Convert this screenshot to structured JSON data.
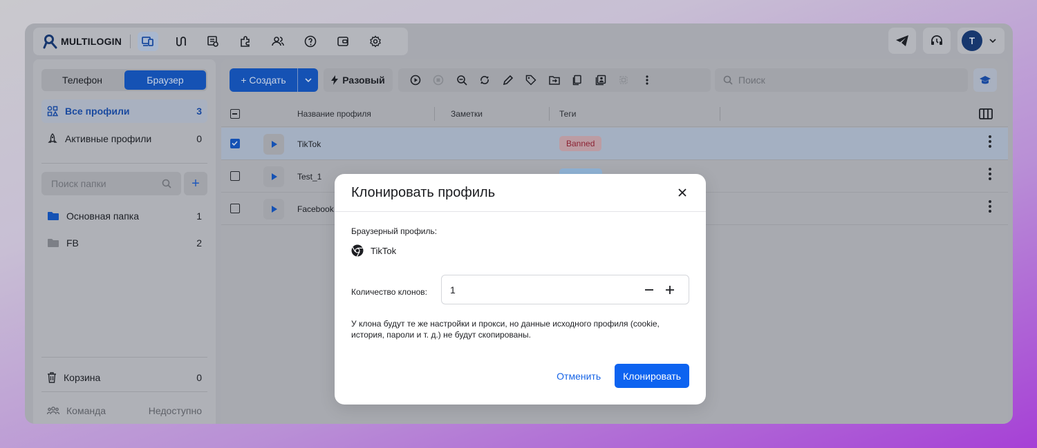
{
  "app": {
    "brand": "MULTILOGIN"
  },
  "topbar": {
    "nav_icons": [
      "profiles-icon",
      "routes-icon",
      "proxy-icon",
      "extensions-icon",
      "team-icon",
      "help-icon",
      "wallet-icon",
      "settings-icon"
    ],
    "right": {
      "avatar_letter": "T"
    }
  },
  "sidebar": {
    "tabs": [
      "Телефон",
      "Браузер"
    ],
    "active_tab": "Браузер",
    "all_profiles": {
      "label": "Все профили",
      "count": "3"
    },
    "active_profiles": {
      "label": "Активные профили",
      "count": "0"
    },
    "folder_search_placeholder": "Поиск папки",
    "folders": [
      {
        "label": "Основная папка",
        "count": "1",
        "color": "#1552b4"
      },
      {
        "label": "FB",
        "count": "2",
        "color": "#7c7f86"
      }
    ],
    "trash": {
      "label": "Корзина",
      "count": "0"
    },
    "team": {
      "label": "Команда",
      "status": "Недоступно"
    }
  },
  "toolbar": {
    "create_label": "+ Создать",
    "oneoff_label": "Разовый",
    "search_placeholder": "Поиск"
  },
  "table": {
    "columns": [
      "Название профиля",
      "Заметки",
      "Теги"
    ],
    "rows": [
      {
        "name": "TikTok",
        "tag": "Banned",
        "selected": true
      },
      {
        "name": "Test_1",
        "tag": "",
        "selected": false
      },
      {
        "name": "Facebook",
        "tag": "",
        "selected": false
      }
    ]
  },
  "modal": {
    "title": "Клонировать профиль",
    "profile_label": "Браузерный профиль:",
    "profile_name": "TikTok",
    "quantity_label": "Количество клонов:",
    "quantity_value": "1",
    "note": "У клона будут те же настройки и прокси, но данные исходного профиля (cookie, история, пароли и т. д.) не будут скопированы.",
    "cancel_label": "Отменить",
    "clone_label": "Клонировать"
  },
  "colors": {
    "accent": "#0d63f0",
    "banned_tag": "#8c2233"
  }
}
